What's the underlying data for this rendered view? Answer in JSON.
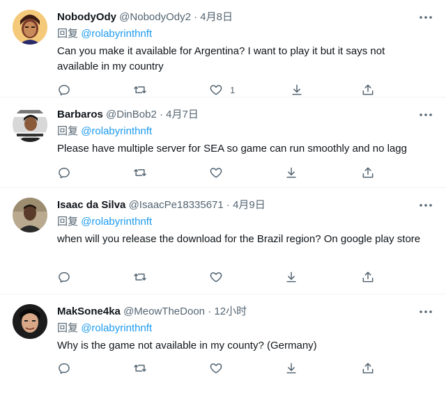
{
  "colors": {
    "accent": "#1d9bf0",
    "muted": "#536471",
    "text": "#0f1419",
    "divider": "#eff3f4"
  },
  "reply_prefix": "回复",
  "tweets": [
    {
      "name": "NobodyOdy",
      "handle": "@NobodyOdy2",
      "separator": "·",
      "time": "4月8日",
      "mention": "@rolabyrinthnft",
      "text": "Can you make it available for Argentina? I want to play it but it says not available in my country",
      "like_count": "1"
    },
    {
      "name": "Barbaros",
      "handle": "@DinBob2",
      "separator": "·",
      "time": "4月7日",
      "mention": "@rolabyrinthnft",
      "text": "Please have multiple server for SEA so game can run smoothly and no lagg",
      "like_count": ""
    },
    {
      "name": "Isaac da Silva",
      "handle": "@IsaacPe18335671",
      "separator": "·",
      "time": "4月9日",
      "mention": "@rolabyrinthnft",
      "text": "when will you release the download for the Brazil region?  On google play store",
      "like_count": ""
    },
    {
      "name": "MakSone4ka",
      "handle": "@MeowTheDoon",
      "separator": "·",
      "time": "12小时",
      "mention": "@rolabyrinthnft",
      "text": "Why is the game not available in my county? (Germany)",
      "like_count": ""
    }
  ]
}
